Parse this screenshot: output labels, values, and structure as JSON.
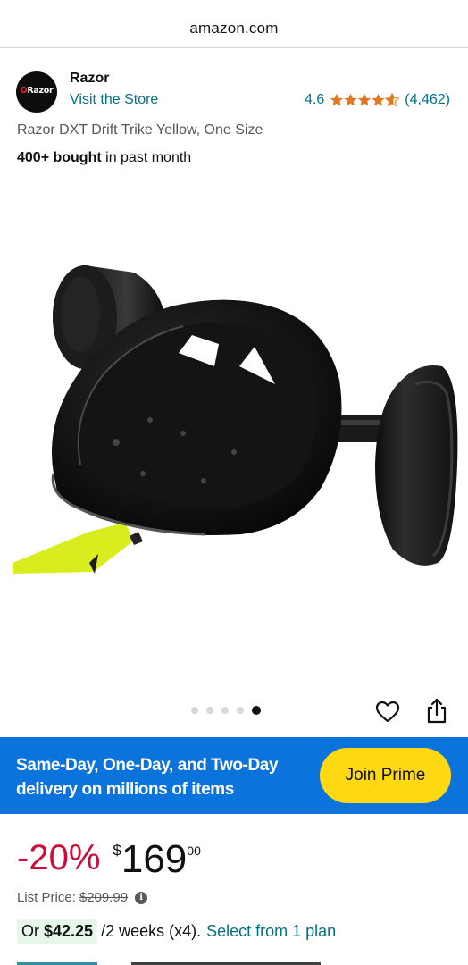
{
  "browser": {
    "url": "amazon.com"
  },
  "brand": {
    "logo_text": "Razor",
    "name": "Razor",
    "visit_store": "Visit the Store",
    "rating": "4.6",
    "rating_value": 4.6,
    "rating_count": "(4,462)",
    "star_color": "#de7921"
  },
  "product": {
    "title": "Razor DXT Drift Trike Yellow, One Size",
    "bought_bold": "400+ bought",
    "bought_rest": " in past month"
  },
  "gallery": {
    "image_count": 5,
    "active_index": 4
  },
  "prime": {
    "banner_line1": "Same-Day, One-Day, and Two-Day",
    "banner_line2": "delivery on millions of items",
    "button": "Join Prime",
    "banner_color": "#0a73dc",
    "button_color": "#fed813"
  },
  "price": {
    "discount": "-20%",
    "currency": "$",
    "whole": "169",
    "fraction": "00",
    "list_label": "List Price: ",
    "list_value": "$209.99",
    "discount_color": "#cc0c39"
  },
  "installment": {
    "amount_prefix": "Or ",
    "amount": "$42.25",
    "terms": "/2 weeks (x4).",
    "link": "Select from 1 plan"
  },
  "colors": {
    "link": "#007185",
    "text": "#0f1111",
    "secondary": "#565959"
  }
}
